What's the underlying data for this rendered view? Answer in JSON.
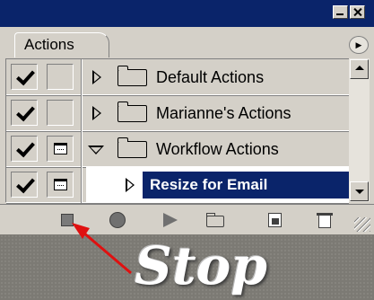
{
  "window": {
    "title": ""
  },
  "palette": {
    "tab_label": "Actions",
    "menu_icon": "flyout-menu-icon"
  },
  "actions": [
    {
      "label": "Default Actions",
      "checked": true,
      "dialog": false,
      "expanded": false,
      "type": "set"
    },
    {
      "label": "Marianne's Actions",
      "checked": true,
      "dialog": false,
      "expanded": false,
      "type": "set"
    },
    {
      "label": "Workflow Actions",
      "checked": true,
      "dialog": true,
      "expanded": true,
      "type": "set"
    },
    {
      "label": "Resize for Email",
      "checked": true,
      "dialog": true,
      "expanded": false,
      "type": "action",
      "selected": true
    }
  ],
  "toolbar": {
    "buttons": [
      "stop-icon",
      "record-icon",
      "play-icon",
      "new-set-icon",
      "new-action-icon",
      "trash-icon"
    ]
  },
  "annotation": {
    "text": "Stop",
    "arrow_color": "#e01010"
  },
  "colors": {
    "selection": "#0a246a",
    "panel": "#d4d0c8"
  }
}
